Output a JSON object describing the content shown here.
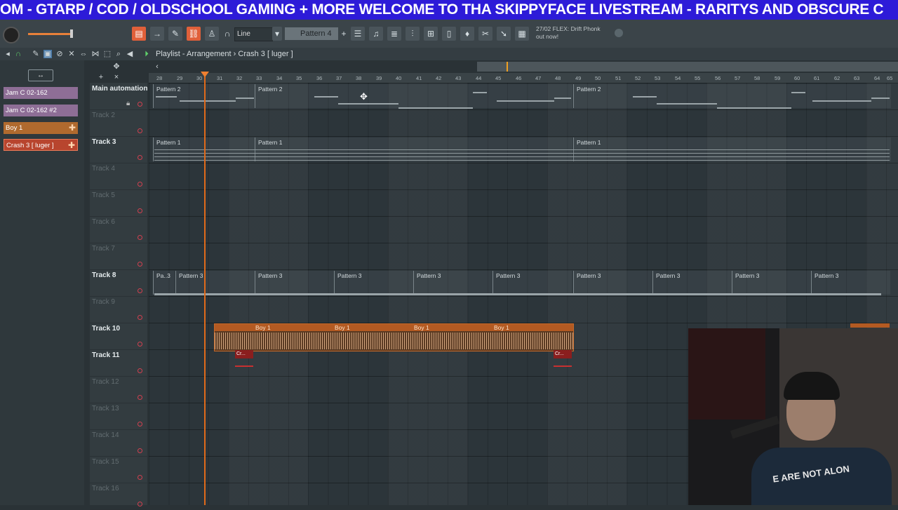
{
  "ticker": {
    "text": "OM - GTARP / COD / OLDSCHOOL GAMING + MORE  WELCOME TO THA SKIPPYFACE LIVESTREAM  - RARITYS AND OBSCURE C"
  },
  "toolbar": {
    "snap_mode": "Line",
    "pattern_selector": "Pattern 4",
    "news_line1": "27/02  FLEX: Drift Phonk",
    "news_line2": "out now!"
  },
  "playlist": {
    "title": "Playlist - Arrangement › Crash 3 [ luger ]",
    "clip_list_icon": "↔",
    "clips": [
      {
        "name": "Jam C 02-162",
        "color": "#8e6e96"
      },
      {
        "name": "Jam C 02-162 #2",
        "color": "#8e6e96"
      },
      {
        "name": "Boy 1",
        "color": "#b06a2e"
      },
      {
        "name": "Crash 3 [ luger ]",
        "color": "#b8452e"
      }
    ],
    "tracks": [
      {
        "name": "Main automation",
        "active": true
      },
      {
        "name": "Track 2",
        "active": false
      },
      {
        "name": "Track 3",
        "active": true
      },
      {
        "name": "Track 4",
        "active": false
      },
      {
        "name": "Track 5",
        "active": false
      },
      {
        "name": "Track 6",
        "active": false
      },
      {
        "name": "Track 7",
        "active": false
      },
      {
        "name": "Track 8",
        "active": true
      },
      {
        "name": "Track 9",
        "active": false
      },
      {
        "name": "Track 10",
        "active": true
      },
      {
        "name": "Track 11",
        "active": true
      },
      {
        "name": "Track 12",
        "active": false
      },
      {
        "name": "Track 13",
        "active": false
      },
      {
        "name": "Track 14",
        "active": false
      },
      {
        "name": "Track 15",
        "active": false
      },
      {
        "name": "Track 16",
        "active": false
      }
    ],
    "bars": [
      "28",
      "29",
      "30",
      "31",
      "32",
      "33",
      "34",
      "35",
      "36",
      "37",
      "38",
      "39",
      "40",
      "41",
      "42",
      "43",
      "44",
      "45",
      "46",
      "47",
      "48",
      "49",
      "50",
      "51",
      "52",
      "53",
      "54",
      "55",
      "56",
      "57",
      "58",
      "59",
      "60",
      "61",
      "62",
      "63",
      "64",
      "65"
    ],
    "patterns": {
      "pattern2": "Pattern 2",
      "pattern1": "Pattern 1",
      "pattern3": "Pattern 3",
      "pattern3_short": "Pa..3",
      "boy1": "Boy 1",
      "crash_short": "Cr..."
    }
  },
  "webcam": {
    "shirt_text": "E ARE NOT ALON"
  }
}
